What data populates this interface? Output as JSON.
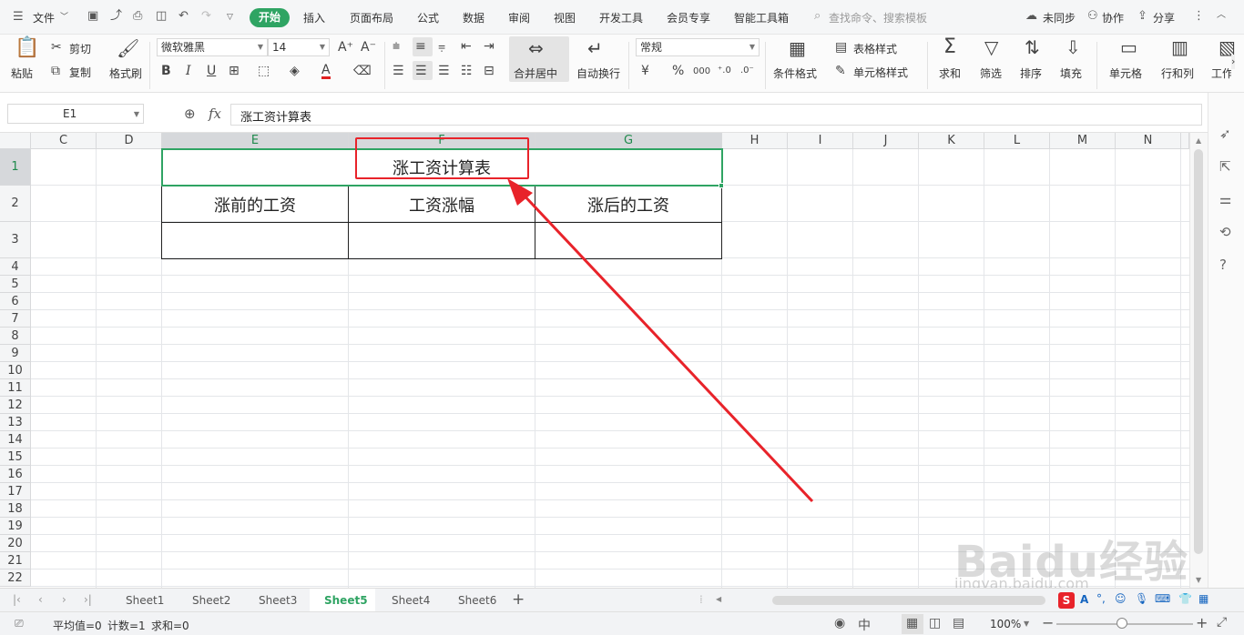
{
  "menu": {
    "file": "文件",
    "tabs": [
      "开始",
      "插入",
      "页面布局",
      "公式",
      "数据",
      "审阅",
      "视图",
      "开发工具",
      "会员专享",
      "智能工具箱"
    ],
    "search_placeholder": "查找命令、搜索模板",
    "right": [
      "未同步",
      "协作",
      "分享"
    ]
  },
  "ribbon": {
    "paste": "粘贴",
    "cut": "剪切",
    "copy": "复制",
    "format_painter": "格式刷",
    "font_name": "微软雅黑",
    "font_size": "14",
    "merge_center": "合并居中",
    "wrap_text": "自动换行",
    "number_format": "常规",
    "conditional_format": "条件格式",
    "table_style": "表格样式",
    "cell_style": "单元格样式",
    "sum": "求和",
    "filter": "筛选",
    "sort": "排序",
    "fill": "填充",
    "cell": "单元格",
    "row_col": "行和列",
    "worksheet": "工作表"
  },
  "formula": {
    "name_box": "E1",
    "fx": "fx",
    "content": "涨工资计算表"
  },
  "grid": {
    "columns": [
      "C",
      "D",
      "E",
      "F",
      "G",
      "H",
      "I",
      "J",
      "K",
      "L",
      "M",
      "N"
    ],
    "rows": [
      "1",
      "2",
      "3",
      "4",
      "5",
      "6",
      "7",
      "8",
      "9",
      "10",
      "11",
      "12",
      "13",
      "14",
      "15",
      "16",
      "17",
      "18",
      "19",
      "20",
      "21",
      "22"
    ],
    "title": "涨工资计算表",
    "headers": [
      "涨前的工资",
      "工资涨幅",
      "涨后的工资"
    ]
  },
  "sheets": {
    "tabs": [
      "Sheet1",
      "Sheet2",
      "Sheet3",
      "Sheet5",
      "Sheet4",
      "Sheet6"
    ],
    "active": "Sheet5"
  },
  "status": {
    "average": "平均值=0",
    "count": "计数=1",
    "sum": "求和=0",
    "zoom": "100%"
  },
  "watermark": {
    "logo": "Baidu经验",
    "url": "jingyan.baidu.com"
  },
  "colors": {
    "accent": "#2fa463",
    "annotation": "#e8232a"
  }
}
